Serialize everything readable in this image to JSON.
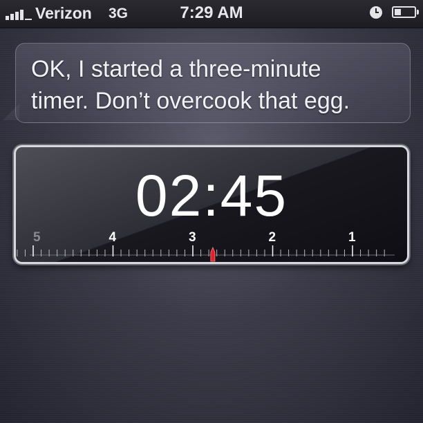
{
  "status_bar": {
    "carrier": "Verizon",
    "network": "3G",
    "time": "7:29 AM"
  },
  "siri_response": {
    "line1": "OK, I started a three-minute",
    "line2": "timer. Don’t overcook that egg."
  },
  "timer": {
    "display": "02:45",
    "remaining_minutes": 2.75,
    "scale_min": 0.5,
    "scale_max": 5.25,
    "scale_labels": [
      "5",
      "4",
      "3",
      "2",
      "1"
    ],
    "indicator_color": "#e0202a"
  }
}
